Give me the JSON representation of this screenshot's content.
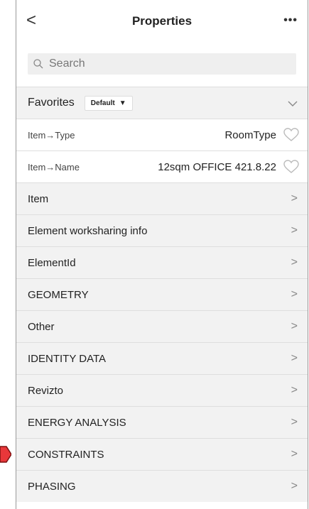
{
  "header": {
    "back_glyph": "<",
    "title": "Properties",
    "more_glyph": "•••"
  },
  "search": {
    "placeholder": "Search"
  },
  "favorites": {
    "label": "Favorites",
    "preset": "Default",
    "preset_caret": "▼",
    "expand_glyph": "⌄"
  },
  "properties": [
    {
      "key": "Item→Type",
      "value": "RoomType"
    },
    {
      "key": "Item→Name",
      "value": "12sqm OFFICE 421.8.22"
    }
  ],
  "groups": [
    "Item",
    "Element worksharing info",
    "ElementId",
    "GEOMETRY",
    "Other",
    "IDENTITY DATA",
    "Revizto",
    "ENERGY ANALYSIS",
    "CONSTRAINTS",
    "PHASING"
  ],
  "chevron_glyph": ">",
  "colors": {
    "highlight_arrow": "#e8373a",
    "row_bg": "#f2f2f2",
    "divider": "#dedede"
  }
}
